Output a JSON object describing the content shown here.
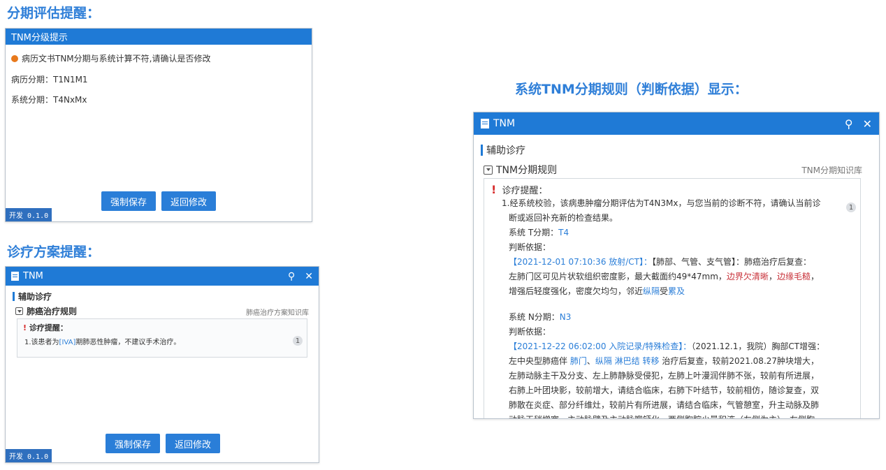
{
  "section_titles": {
    "staging": "分期评估提醒：",
    "treatment": "诊疗方案提醒：",
    "rules": "系统TNM分期规则（判断依据）显示："
  },
  "staging_dialog": {
    "title": "TNM分级提示",
    "warning": "病历文书TNM分期与系统计算不符,请确认是否修改",
    "record_stage": "病历分期：T1N1M1",
    "system_stage": "系统分期：T4NxMx",
    "force_save": "强制保存",
    "back_edit": "返回修改",
    "version": "开发 0.1.0"
  },
  "treatment_dialog": {
    "title": "TNM",
    "heading": "辅助诊疗",
    "rule_title": "肺癌治疗规则",
    "kb_link": "肺癌治疗方案知识库",
    "alert_title": "诊疗提醒：",
    "alert_prefix": "1.该患者为",
    "alert_stage": "[IVA]",
    "alert_suffix": "期肺恶性肿瘤，不建议手术治疗。",
    "badge": "1",
    "force_save": "强制保存",
    "back_edit": "返回修改",
    "version": "开发 0.1.0"
  },
  "rules_dialog": {
    "title": "TNM",
    "heading": "辅助诊疗",
    "rule_title": "TNM分期规则",
    "kb_link": "TNM分期知识库",
    "alert_title": "诊疗提醒：",
    "badge": "1",
    "line1": "1.经系统校验，该病患肿瘤分期评估为T4N3Mx，与您当前的诊断不符，请确认当前诊",
    "line2": "断或返回补充新的检查结果。",
    "t_label": "系统 T分期：",
    "t_value": "T4",
    "basis_label": "判断依据：",
    "t_ref": "【2021-12-01 07:10:36 放射/CT】：",
    "t_ref_tag": "【肺部、气管、支气管】：肺癌治疗后复查：",
    "t_l1a": "左肺门区可见片状软组织密度影，最大截面约49*47mm，",
    "t_l1b": "边界欠清晰",
    "t_l1c": "，",
    "t_l1d": "边缘毛糙",
    "t_l1e": "，",
    "t_l2a": "增强后轻度强化，密度欠均匀，邻近",
    "t_l2b": "纵隔",
    "t_l2c": "受",
    "t_l2d": "累及",
    "n_label": "系统 N分期：",
    "n_value": "N3",
    "n_ref": "【2021-12-22 06:02:00 入院记录/特殊检查】：",
    "n_ref_rest": "（2021.12.1，我院）胸部CT增强：",
    "n_l1a": "左中央型肺癌伴 ",
    "n_l1b": "肺门",
    "n_l1c": "、",
    "n_l1d": "纵隔 淋巴结 转移",
    "n_l1e": " 治疗后复查，较前2021.08.27肿块增大，",
    "n_l2": "左肺动脉主干及分支、左上肺静脉受侵犯，左肺上叶漫润伴肺不张，较前有所进展，",
    "n_l3": "右肺上叶团块影，较前增大，请结合临床，右肺下叶结节，较前相仿，随诊复查，双",
    "n_l4": "肺散在炎症、部分纤维灶，较前片有所进展，请结合临床，气管憩室，升主动脉及肺",
    "n_l5": "动脉干稍增宽，主动脉壁及主动脉瓣钙化，两侧胸腔少量积液（左侧为主），左侧胸"
  },
  "icons": {
    "pin": "pin-icon",
    "close": "close-icon",
    "document": "document-icon",
    "collapse": "collapse-icon",
    "warning": "warning-icon"
  },
  "colors": {
    "accent": "#1f7ad6",
    "section_title": "#2f7fd8",
    "warning_dot": "#e8791c",
    "alert_red": "#d62b2b"
  }
}
